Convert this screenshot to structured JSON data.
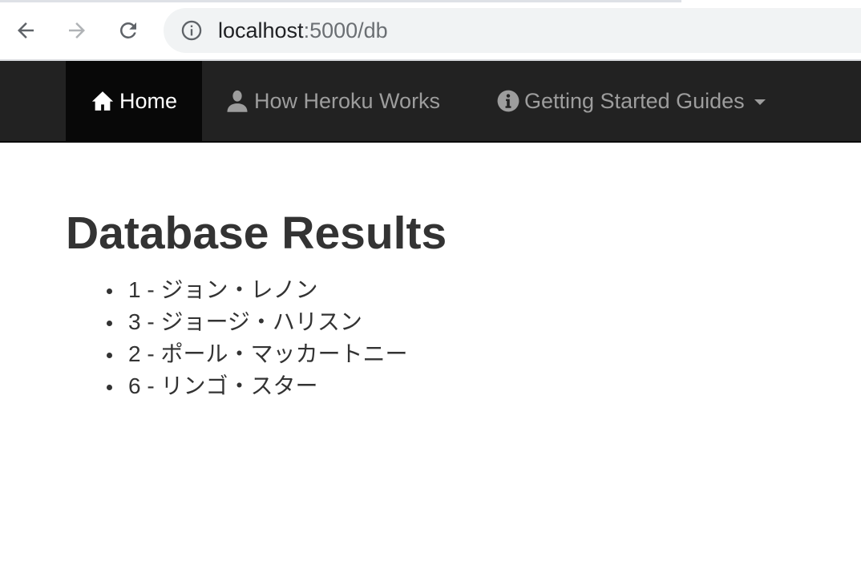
{
  "browser": {
    "url_host": "localhost",
    "url_rest": ":5000/db",
    "icons": {
      "back": "arrow-left-icon",
      "forward": "arrow-right-icon",
      "reload": "reload-icon",
      "site_info": "info-circle-icon"
    }
  },
  "navbar": {
    "items": [
      {
        "label": "Home",
        "icon": "home-icon",
        "active": true
      },
      {
        "label": "How Heroku Works",
        "icon": "user-icon",
        "active": false
      },
      {
        "label": "Getting Started Guides",
        "icon": "info-sign-icon",
        "active": false,
        "dropdown": true
      }
    ]
  },
  "main": {
    "title": "Database Results",
    "results": [
      "1 - ジョン・レノン",
      "3 - ジョージ・ハリスン",
      "2 - ポール・マッカートニー",
      "6 - リンゴ・スター"
    ]
  },
  "colors": {
    "navbar_bg": "#222222",
    "navbar_active_bg": "#080808",
    "navbar_text": "#9d9d9d",
    "title_text": "#333333"
  }
}
